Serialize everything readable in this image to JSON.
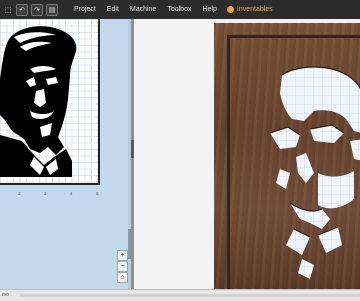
{
  "toolbar": {
    "tools": [
      {
        "icon": "select-tool-icon",
        "glyph": "⬚"
      },
      {
        "icon": "undo-icon",
        "glyph": "↶"
      },
      {
        "icon": "redo-icon",
        "glyph": "↷"
      },
      {
        "icon": "image-icon",
        "glyph": "▤"
      }
    ],
    "menus": [
      "Project",
      "Edit",
      "Machine",
      "Toolbox",
      "Help"
    ],
    "inventables_label": "Inventables"
  },
  "canvas": {
    "ruler_labels": [
      "2",
      "3",
      "4",
      "5"
    ],
    "zoom_in": "+",
    "zoom_out": "−",
    "home": "⌂"
  },
  "status": {
    "zoom_text": "mo"
  },
  "colors": {
    "toolbar_bg": "#2c2c2c",
    "canvas_bg": "#c2d8ec",
    "brand_accent": "#e4a84a",
    "wood": "#6b4530"
  }
}
